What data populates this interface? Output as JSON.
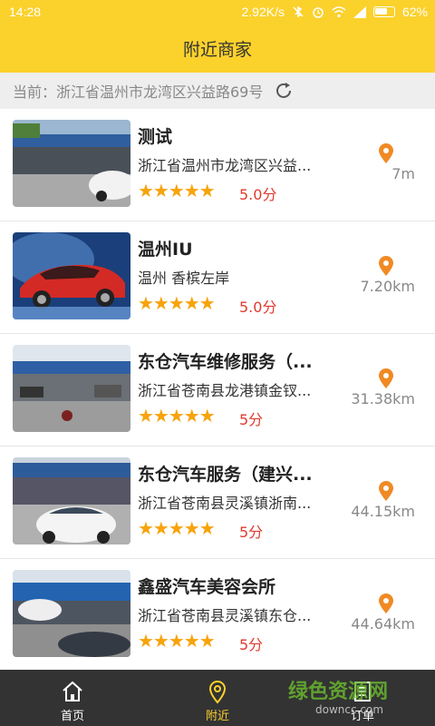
{
  "status_bar": {
    "time": "14:28",
    "net_speed": "2.92K/s",
    "battery": "62%"
  },
  "title": "附近商家",
  "location": {
    "text": "当前：浙江省温州市龙湾区兴益路69号",
    "refresh_icon": "refresh-icon"
  },
  "shops": [
    {
      "name": "测试",
      "address": "浙江省温州市龙湾区兴益...",
      "stars": "★★★★★",
      "rating": "5.0分",
      "distance": "7m"
    },
    {
      "name": "温州IU",
      "address": "温州 香槟左岸",
      "stars": "★★★★★",
      "rating": "5.0分",
      "distance": "7.20km"
    },
    {
      "name": "东仓汽车维修服务（...",
      "address": "浙江省苍南县龙港镇金钗...",
      "stars": "★★★★★",
      "rating": "5分",
      "distance": "31.38km"
    },
    {
      "name": "东仓汽车服务（建兴...",
      "address": "浙江省苍南县灵溪镇浙南...",
      "stars": "★★★★★",
      "rating": "5分",
      "distance": "44.15km"
    },
    {
      "name": "鑫盛汽车美容会所",
      "address": "浙江省苍南县灵溪镇东仓...",
      "stars": "★★★★★",
      "rating": "5分",
      "distance": "44.64km"
    }
  ],
  "nav": {
    "home": "首页",
    "nearby": "附近",
    "orders": "订单"
  },
  "watermark": {
    "logo": "绿色资源网",
    "url": "downcc.com"
  },
  "colors": {
    "accent": "#fbd12c",
    "star": "#f7a30b",
    "rating": "#e03a2e",
    "pin": "#f08a24",
    "nav_bg": "#333333"
  }
}
